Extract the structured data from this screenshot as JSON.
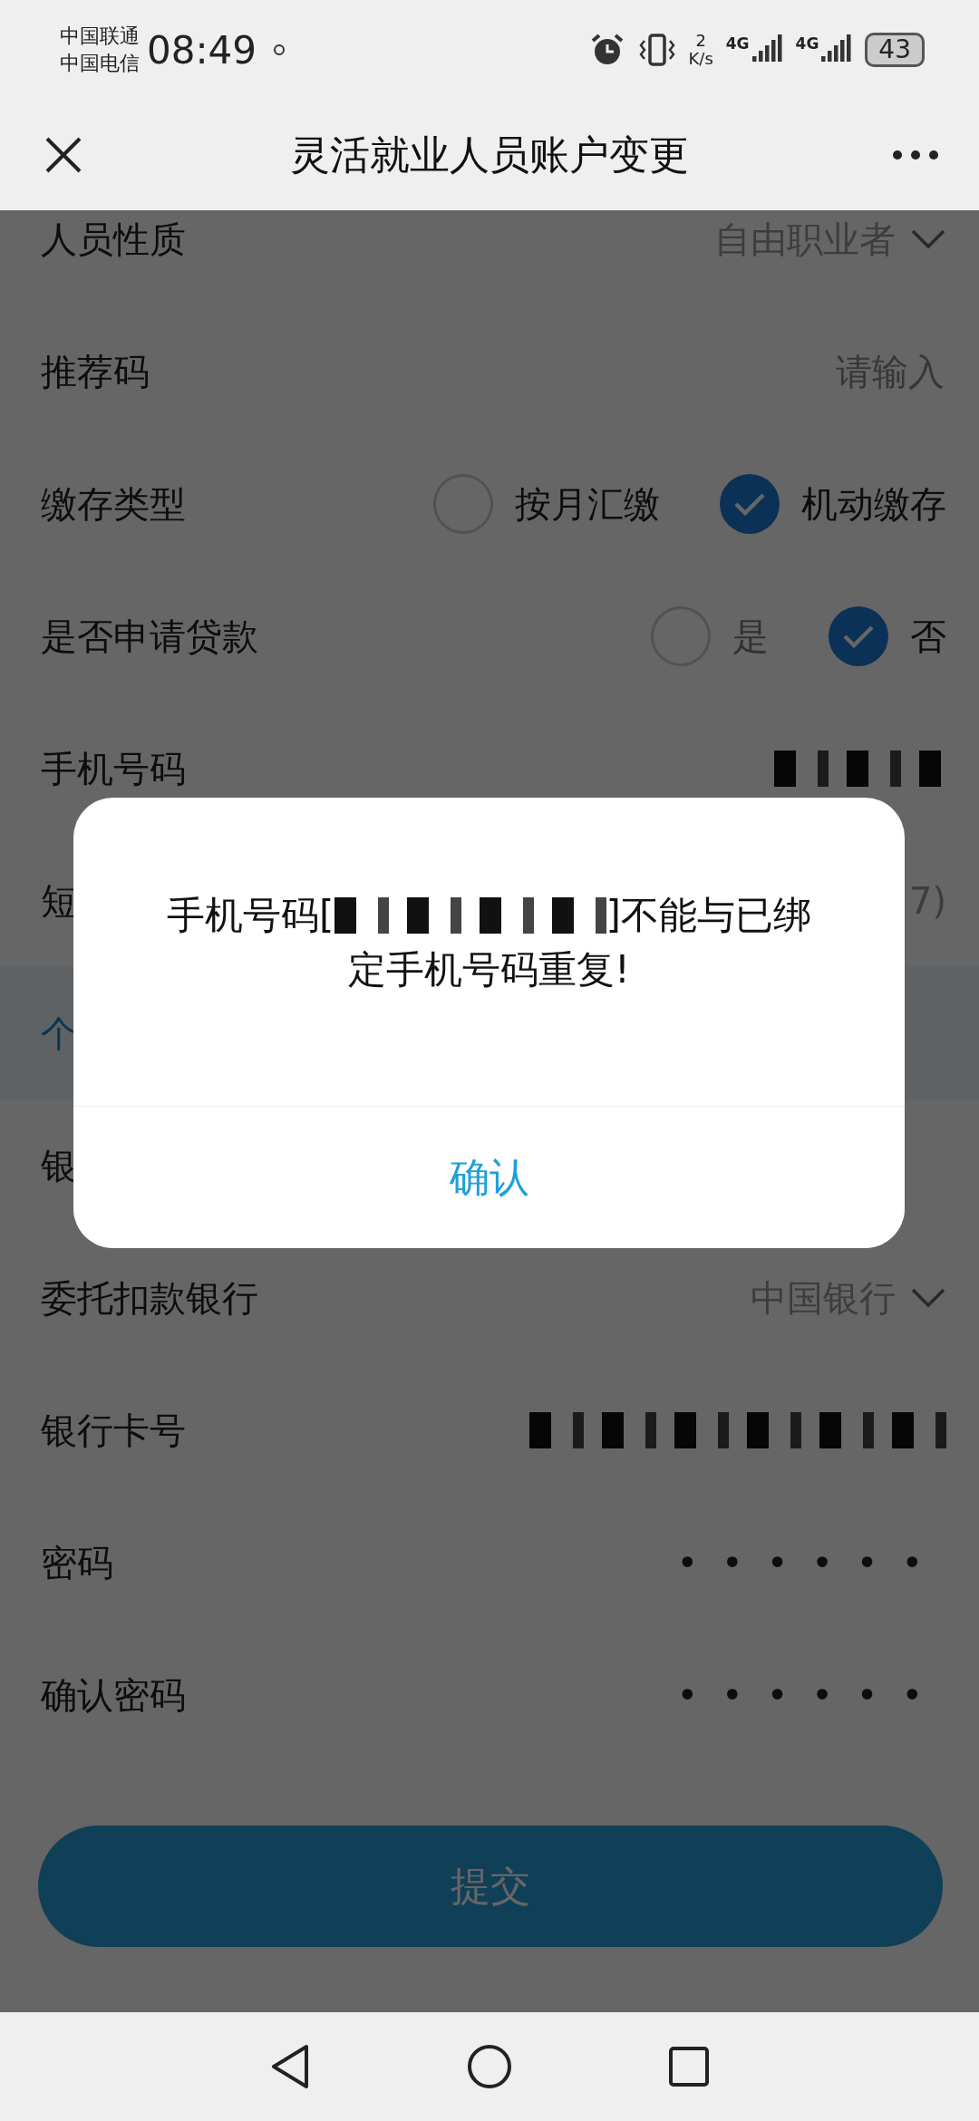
{
  "status_bar": {
    "carriers": [
      "中国联通",
      "中国电信"
    ],
    "time": "08:49",
    "speed": "2",
    "speed_unit": "K/s",
    "networks": [
      "4G",
      "4G"
    ],
    "battery": "43"
  },
  "header": {
    "title": "灵活就业人员账户变更"
  },
  "form": [
    {
      "kind": "select",
      "label": "人员性质",
      "value": "自由职业者"
    },
    {
      "kind": "input",
      "label": "推荐码",
      "placeholder": "请输入"
    },
    {
      "kind": "radio",
      "label": "缴存类型",
      "options": [
        {
          "label": "按月汇缴",
          "selected": false,
          "disabled": false
        },
        {
          "label": "机动缴存",
          "selected": true,
          "disabled": false
        }
      ]
    },
    {
      "kind": "radio",
      "label": "是否申请贷款",
      "options": [
        {
          "label": "是",
          "selected": false,
          "disabled": true
        },
        {
          "label": "否",
          "selected": true,
          "disabled": false
        }
      ]
    },
    {
      "kind": "redacted",
      "label": "手机号码"
    },
    {
      "kind": "text",
      "label": "短",
      "value": "7)"
    },
    {
      "kind": "section",
      "label": "个"
    },
    {
      "kind": "text",
      "label": "银"
    },
    {
      "kind": "select",
      "label": "委托扣款银行",
      "value": "中国银行"
    },
    {
      "kind": "redacted",
      "label": "银行卡号"
    },
    {
      "kind": "password",
      "label": "密码",
      "value": "••••••"
    },
    {
      "kind": "password",
      "label": "确认密码",
      "value": "••••••"
    }
  ],
  "submit": {
    "label": "提交"
  },
  "dialog": {
    "message_start": "手机号码[",
    "message_end": "]不能与已绑",
    "message_line2": "定手机号码重复!",
    "confirm": "确认"
  }
}
